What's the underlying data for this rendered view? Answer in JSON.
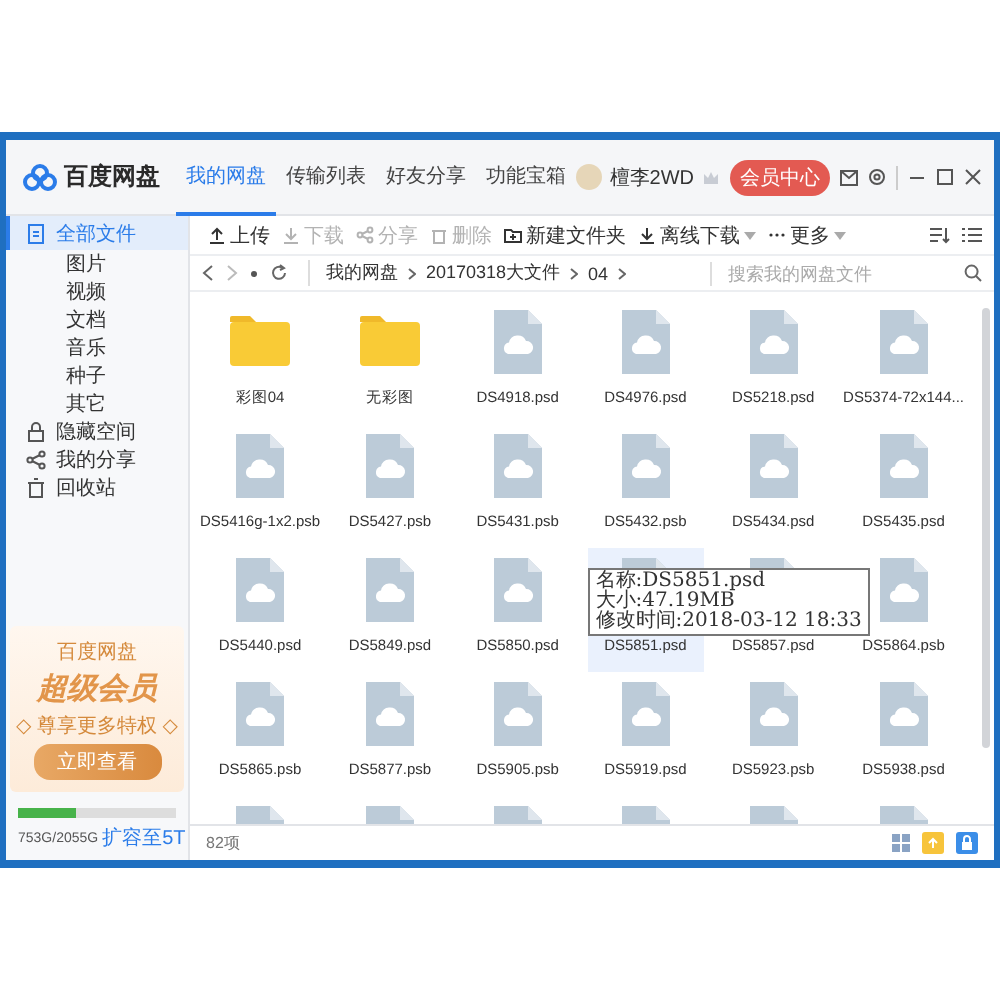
{
  "header": {
    "logo": "百度网盘",
    "tabs": [
      {
        "label": "我的网盘",
        "selected": true
      },
      {
        "label": "传输列表",
        "selected": false
      },
      {
        "label": "好友分享",
        "selected": false
      },
      {
        "label": "功能宝箱",
        "selected": false
      }
    ],
    "user": "檀李2WD",
    "vip_button": "会员中心"
  },
  "toolbar": {
    "actions": [
      {
        "label": "上传",
        "disabled": false,
        "dropdown": false
      },
      {
        "label": "下载",
        "disabled": true,
        "dropdown": false
      },
      {
        "label": "分享",
        "disabled": true,
        "dropdown": false
      },
      {
        "label": "删除",
        "disabled": true,
        "dropdown": false
      },
      {
        "label": "新建文件夹",
        "disabled": false,
        "dropdown": false
      },
      {
        "label": "离线下载",
        "disabled": false,
        "dropdown": true
      },
      {
        "label": "更多",
        "disabled": false,
        "dropdown": true
      }
    ]
  },
  "address": {
    "breadcrumbs": [
      "我的网盘",
      "20170318大文件",
      "04"
    ],
    "search": {
      "placeholder": "搜索我的网盘文件"
    }
  },
  "sidebar": {
    "items": [
      {
        "label": "全部文件",
        "selected": true,
        "children": [
          {
            "label": "图片",
            "selected": false
          },
          {
            "label": "视频",
            "selected": false
          },
          {
            "label": "文档",
            "selected": false
          },
          {
            "label": "音乐",
            "selected": false
          },
          {
            "label": "种子",
            "selected": false
          },
          {
            "label": "其它",
            "selected": false
          }
        ]
      },
      {
        "label": "隐藏空间",
        "selected": false
      },
      {
        "label": "我的分享",
        "selected": false
      },
      {
        "label": "回收站",
        "selected": false
      }
    ]
  },
  "promo": {
    "brand": "百度网盘",
    "title": "超级会员",
    "subtitle": "◇ 尊享更多特权 ◇",
    "button": "立即查看"
  },
  "storage": {
    "level": 0.37,
    "usage": "753G/2055G",
    "upgrade": "扩容至5T"
  },
  "files": [
    {
      "kind": "folder",
      "name": "彩图04",
      "selected": false
    },
    {
      "kind": "folder",
      "name": "无彩图",
      "selected": false
    },
    {
      "kind": "file",
      "name": "DS4918.psd",
      "selected": false
    },
    {
      "kind": "file",
      "name": "DS4976.psd",
      "selected": false
    },
    {
      "kind": "file",
      "name": "DS5218.psd",
      "selected": false
    },
    {
      "kind": "file",
      "name": "DS5374-72x144...",
      "selected": false
    },
    {
      "kind": "file",
      "name": "DS5416g-1x2.psb",
      "selected": false
    },
    {
      "kind": "file",
      "name": "DS5427.psb",
      "selected": false
    },
    {
      "kind": "file",
      "name": "DS5431.psb",
      "selected": false
    },
    {
      "kind": "file",
      "name": "DS5432.psb",
      "selected": false
    },
    {
      "kind": "file",
      "name": "DS5434.psd",
      "selected": false
    },
    {
      "kind": "file",
      "name": "DS5435.psd",
      "selected": false
    },
    {
      "kind": "file",
      "name": "DS5440.psd",
      "selected": false
    },
    {
      "kind": "file",
      "name": "DS5849.psd",
      "selected": false
    },
    {
      "kind": "file",
      "name": "DS5850.psd",
      "selected": false
    },
    {
      "kind": "file",
      "name": "DS5851.psd",
      "selected": true,
      "tooltip": [
        "名称:DS5851.psd",
        "大小:47.19MB",
        "修改时间:2018-03-12 18:33"
      ]
    },
    {
      "kind": "file",
      "name": "DS5857.psd",
      "selected": false
    },
    {
      "kind": "file",
      "name": "DS5864.psb",
      "selected": false
    },
    {
      "kind": "file",
      "name": "DS5865.psb",
      "selected": false
    },
    {
      "kind": "file",
      "name": "DS5877.psb",
      "selected": false
    },
    {
      "kind": "file",
      "name": "DS5905.psb",
      "selected": false
    },
    {
      "kind": "file",
      "name": "DS5919.psd",
      "selected": false
    },
    {
      "kind": "file",
      "name": "DS5923.psb",
      "selected": false
    },
    {
      "kind": "file",
      "name": "DS5938.psd",
      "selected": false
    },
    {
      "kind": "file",
      "selected": false
    },
    {
      "kind": "file",
      "selected": false
    },
    {
      "kind": "file",
      "selected": false
    },
    {
      "kind": "file",
      "selected": false
    },
    {
      "kind": "file",
      "selected": false
    },
    {
      "kind": "file",
      "selected": false
    }
  ],
  "status_bar": {
    "count": "82项"
  }
}
